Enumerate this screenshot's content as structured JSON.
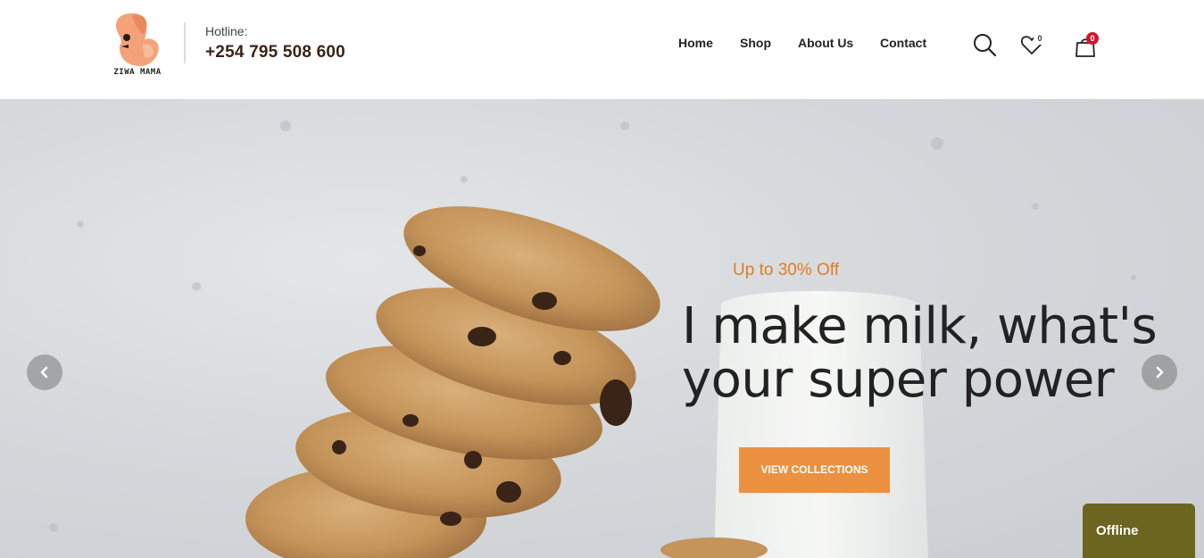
{
  "brand": {
    "logo_text": "ZIWA MAMA"
  },
  "hotline": {
    "label": "Hotline:",
    "number": "+254 795 508 600"
  },
  "nav": {
    "items": [
      "Home",
      "Shop",
      "About Us",
      "Contact"
    ]
  },
  "header_icons": {
    "search": "search-icon",
    "wishlist": "heart-icon",
    "wishlist_count": "0",
    "cart": "bag-icon",
    "cart_count": "0"
  },
  "hero": {
    "promo": "Up to 30% Off",
    "headline_line1": "I make milk, what's",
    "headline_line2": "your super power",
    "cta_label": "VIEW COLLECTIONS",
    "prev_icon": "chevron-left-icon",
    "next_icon": "chevron-right-icon"
  },
  "chat": {
    "status": "Offline"
  },
  "colors": {
    "accent_orange": "#ec913f",
    "promo_orange": "#e07b22",
    "cart_badge": "#d2142a",
    "chat_bg": "#6b6520",
    "logo_peach": "#f3a27a"
  }
}
